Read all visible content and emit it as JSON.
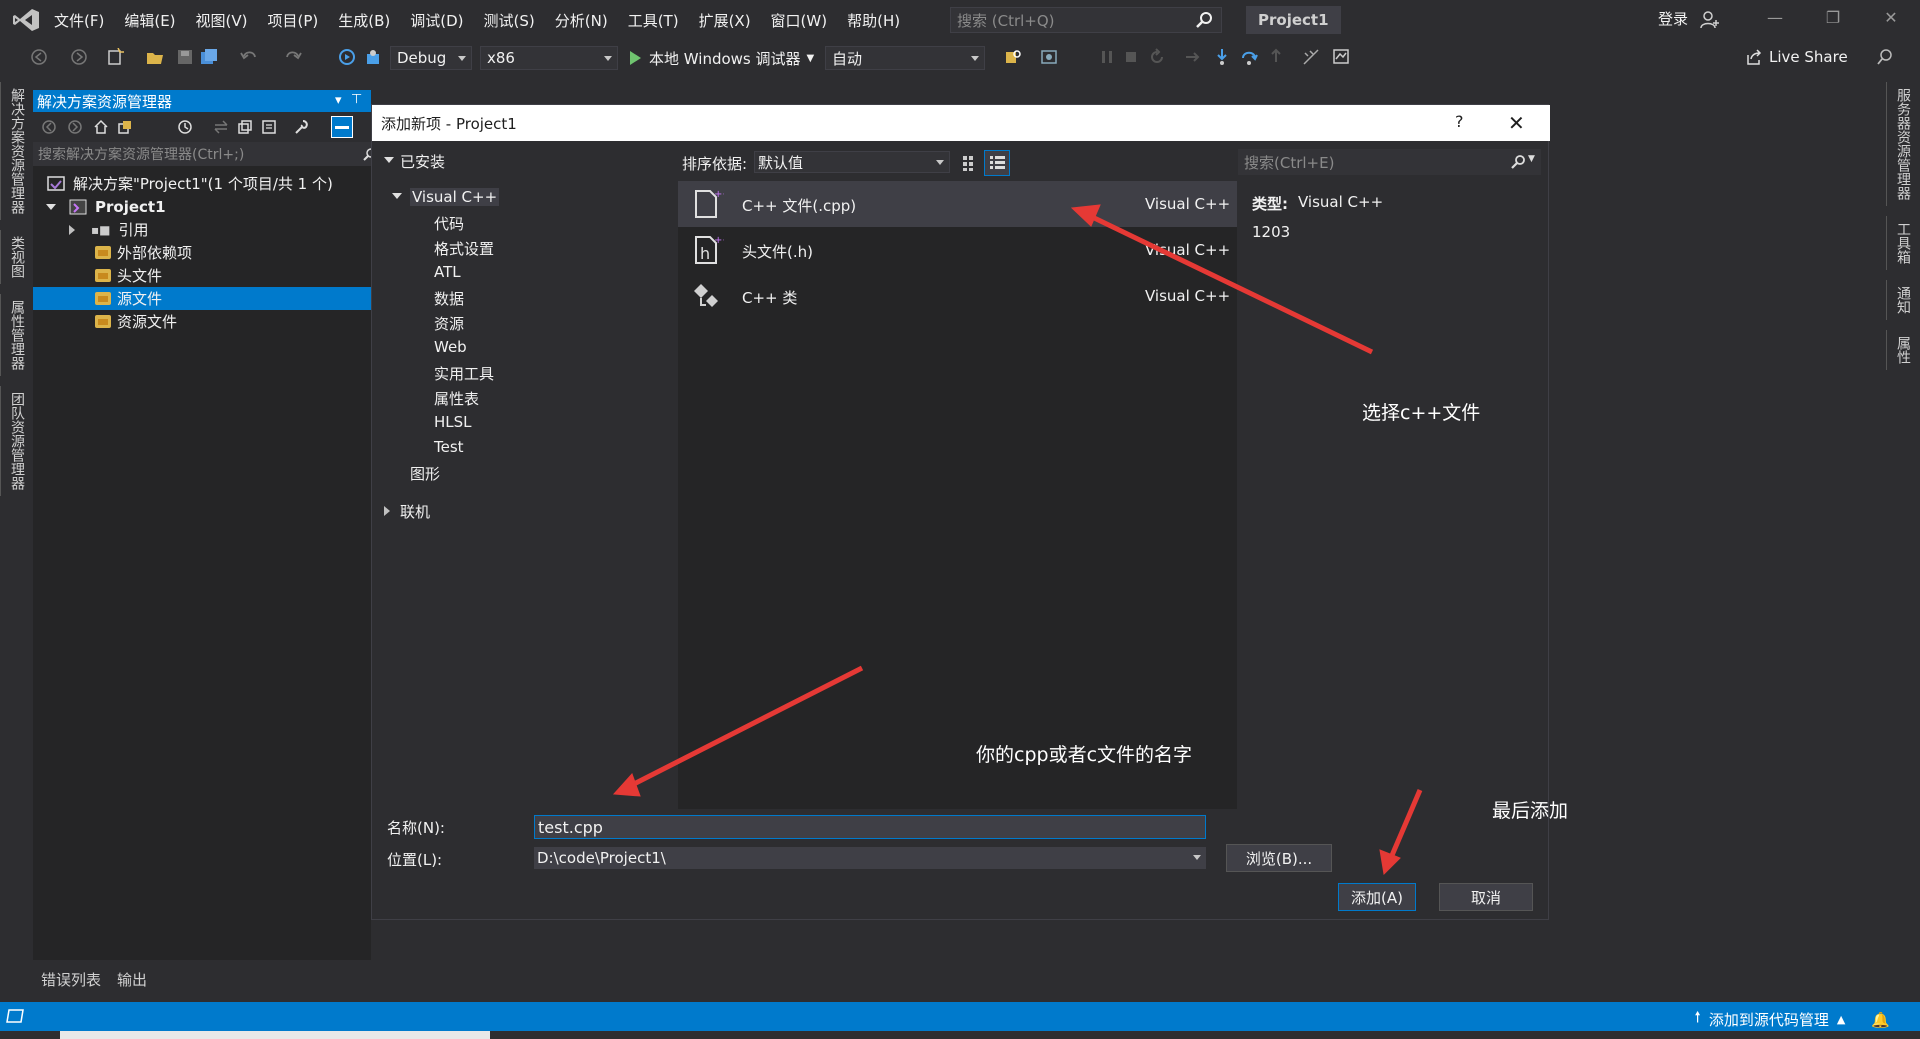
{
  "menubar": {
    "items": [
      "文件(F)",
      "编辑(E)",
      "视图(V)",
      "项目(P)",
      "生成(B)",
      "调试(D)",
      "测试(S)",
      "分析(N)",
      "工具(T)",
      "扩展(X)",
      "窗口(W)",
      "帮助(H)"
    ],
    "search_placeholder": "搜索 (Ctrl+Q)",
    "project_title": "Project1",
    "login": "登录"
  },
  "toolbar": {
    "config": "Debug",
    "platform": "x86",
    "run_label": "本地 Windows 调试器",
    "run_mode": "自动",
    "live_share": "Live Share"
  },
  "left_tabs": [
    "解决方案资源管理器",
    "类视图",
    "属性管理器",
    "团队资源管理器"
  ],
  "right_tabs": [
    "服务器资源管理器",
    "工具箱",
    "通知",
    "属性"
  ],
  "solution_explorer": {
    "title": "解决方案资源管理器",
    "search_placeholder": "搜索解决方案资源管理器(Ctrl+;)",
    "solution": "解决方案\"Project1\"(1 个项目/共 1 个)",
    "project": "Project1",
    "nodes": [
      "引用",
      "外部依赖项",
      "头文件",
      "源文件",
      "资源文件"
    ],
    "selected": "源文件"
  },
  "bottom_tabs": [
    "错误列表",
    "输出"
  ],
  "status": {
    "source_control": "添加到源代码管理"
  },
  "dialog": {
    "title": "添加新项 - Project1",
    "help": "?",
    "installed": "已安装",
    "category_root": "Visual C++",
    "subcategories": [
      "代码",
      "格式设置",
      "ATL",
      "数据",
      "资源",
      "Web",
      "实用工具",
      "属性表",
      "HLSL",
      "Test"
    ],
    "graphics": "图形",
    "online": "联机",
    "sort_label": "排序依据:",
    "sort_value": "默认值",
    "search_placeholder": "搜索(Ctrl+E)",
    "templates": [
      {
        "name": "C++ 文件(.cpp)",
        "lang": "Visual C++",
        "icon": "cpp-file-icon"
      },
      {
        "name": "头文件(.h)",
        "lang": "Visual C++",
        "icon": "header-file-icon"
      },
      {
        "name": "C++ 类",
        "lang": "Visual C++",
        "icon": "cpp-class-icon"
      }
    ],
    "detail_type_label": "类型:",
    "detail_type_value": "Visual C++",
    "detail_number": "1203",
    "name_label": "名称(N):",
    "name_value": "test.cpp",
    "location_label": "位置(L):",
    "location_value": "D:\\code\\Project1\\",
    "browse": "浏览(B)...",
    "add": "添加(A)",
    "cancel": "取消"
  },
  "annotations": {
    "select_cpp": "选择c++文件",
    "file_name": "你的cpp或者c文件的名字",
    "finally_add": "最后添加"
  },
  "colors": {
    "accent": "#007acc",
    "annotation_arrow": "#e53935",
    "background": "#2d2d30"
  }
}
